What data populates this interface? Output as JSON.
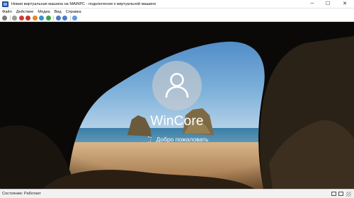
{
  "window": {
    "title": "Новая виртуальная машина на MAINPC - подключение к виртуальной машине",
    "minimize_glyph": "─",
    "maximize_glyph": "☐",
    "close_glyph": "✕"
  },
  "menu": {
    "items": [
      "Файл",
      "Действие",
      "Медиа",
      "Вид",
      "Справка"
    ]
  },
  "toolbar": {
    "buttons": [
      {
        "icon": "ctrl-alt-del-icon",
        "color": "#7a7a7a"
      },
      {
        "icon": "start-icon",
        "color": "#9a9a9a"
      },
      {
        "icon": "turn-off-icon",
        "color": "#d33b2c"
      },
      {
        "icon": "shutdown-icon",
        "color": "#c0392b"
      },
      {
        "icon": "save-icon",
        "color": "#e08a1e"
      },
      {
        "icon": "pause-icon",
        "color": "#3e8ed0"
      },
      {
        "icon": "reset-icon",
        "color": "#3aa64a"
      },
      {
        "icon": "checkpoint-icon",
        "color": "#4a7dc4"
      },
      {
        "icon": "revert-icon",
        "color": "#4a7dc4"
      },
      {
        "icon": "enhanced-session-icon",
        "color": "#5c9bd6"
      }
    ]
  },
  "login": {
    "username": "WinCore",
    "welcome": "Добро пожаловать"
  },
  "status": {
    "text": "Состояние: Работает"
  },
  "colors": {
    "screen_bg": "#070605",
    "sky": "#4f8fc8",
    "sea": "#2f6f97",
    "sand": "#c9a06d"
  }
}
